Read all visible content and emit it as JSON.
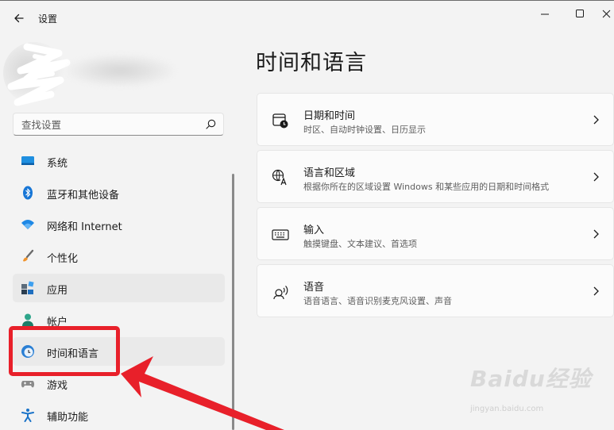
{
  "window": {
    "title": "设置",
    "icons": {
      "back": "arrow-left-icon",
      "minimize": "minimize-icon",
      "maximize": "maximize-icon",
      "close": "close-icon"
    }
  },
  "search": {
    "placeholder": "查找设置",
    "icon": "search-icon"
  },
  "sidebar": {
    "items": [
      {
        "label": "系统",
        "icon": "system-display-icon"
      },
      {
        "label": "蓝牙和其他设备",
        "icon": "bluetooth-icon"
      },
      {
        "label": "网络和 Internet",
        "icon": "wifi-icon"
      },
      {
        "label": "个性化",
        "icon": "brush-icon"
      },
      {
        "label": "应用",
        "icon": "apps-icon"
      },
      {
        "label": "帐户",
        "icon": "account-icon"
      },
      {
        "label": "时间和语言",
        "icon": "globe-clock-icon",
        "selected": true
      },
      {
        "label": "游戏",
        "icon": "gamepad-icon"
      },
      {
        "label": "辅助功能",
        "icon": "accessibility-icon"
      }
    ]
  },
  "main": {
    "title": "时间和语言",
    "cards": [
      {
        "title": "日期和时间",
        "desc": "时区、自动时钟设置、日历显示",
        "icon": "calendar-clock-icon"
      },
      {
        "title": "语言和区域",
        "desc": "根据你所在的区域设置 Windows 和某些应用的日期和时间格式",
        "icon": "language-icon"
      },
      {
        "title": "输入",
        "desc": "触摸键盘、文本建议、首选项",
        "icon": "keyboard-icon"
      },
      {
        "title": "语音",
        "desc": "语音语言、语音识别麦克风设置、声音",
        "icon": "speech-icon"
      }
    ]
  },
  "annotation": {
    "color": "#e8202a"
  },
  "watermark": {
    "main": "Baidu经验",
    "sub": "jingyan.baidu.com"
  },
  "colors": {
    "background": "#f3f3f3",
    "card": "#fbfbfb",
    "accent": "#0067c0"
  }
}
